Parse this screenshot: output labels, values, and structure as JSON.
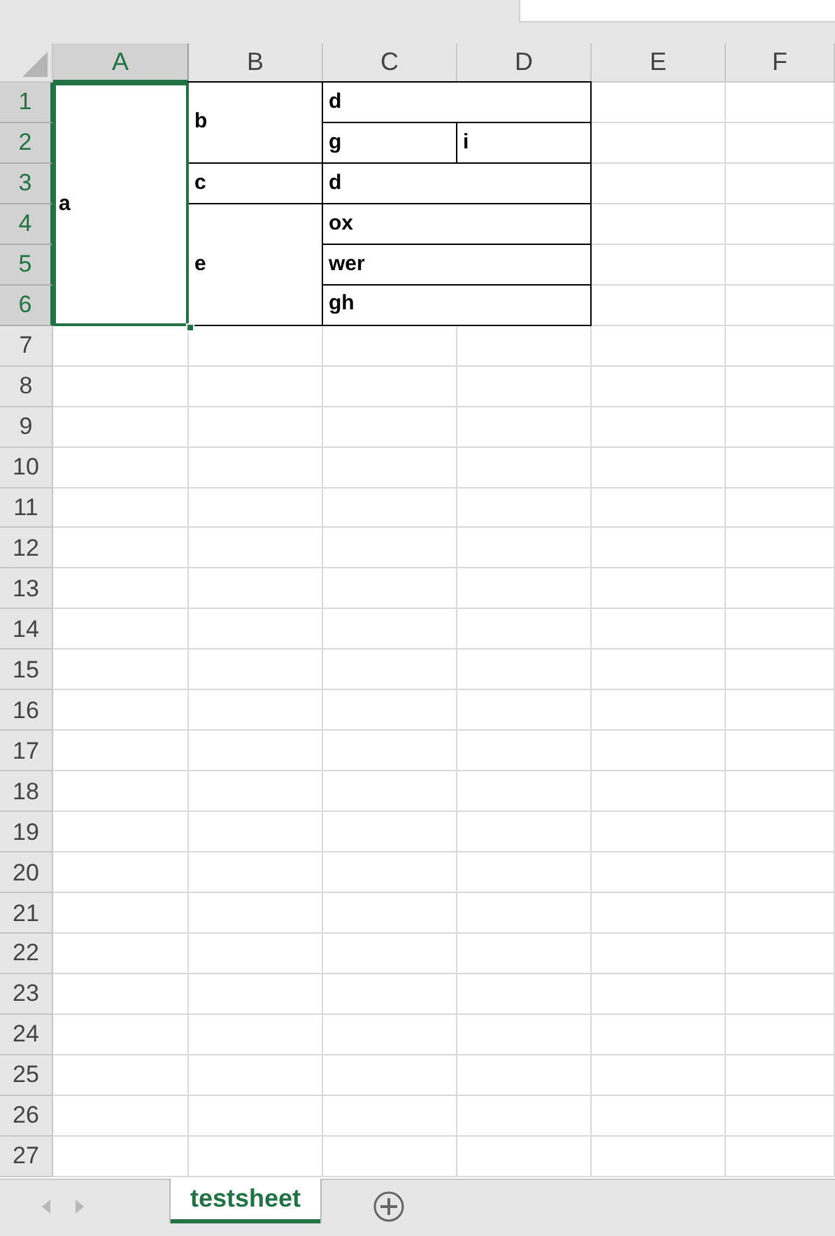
{
  "columns": [
    {
      "label": "A",
      "selected": true
    },
    {
      "label": "B",
      "selected": false
    },
    {
      "label": "C",
      "selected": false
    },
    {
      "label": "D",
      "selected": false
    },
    {
      "label": "E",
      "selected": false
    },
    {
      "label": "F",
      "selected": false
    }
  ],
  "rows": [
    {
      "label": "1",
      "selected": true
    },
    {
      "label": "2",
      "selected": true
    },
    {
      "label": "3",
      "selected": true
    },
    {
      "label": "4",
      "selected": true
    },
    {
      "label": "5",
      "selected": true
    },
    {
      "label": "6",
      "selected": true
    },
    {
      "label": "7",
      "selected": false
    },
    {
      "label": "8",
      "selected": false
    },
    {
      "label": "9",
      "selected": false
    },
    {
      "label": "10",
      "selected": false
    },
    {
      "label": "11",
      "selected": false
    },
    {
      "label": "12",
      "selected": false
    },
    {
      "label": "13",
      "selected": false
    },
    {
      "label": "14",
      "selected": false
    },
    {
      "label": "15",
      "selected": false
    },
    {
      "label": "16",
      "selected": false
    },
    {
      "label": "17",
      "selected": false
    },
    {
      "label": "18",
      "selected": false
    },
    {
      "label": "19",
      "selected": false
    },
    {
      "label": "20",
      "selected": false
    },
    {
      "label": "21",
      "selected": false
    },
    {
      "label": "22",
      "selected": false
    },
    {
      "label": "23",
      "selected": false
    },
    {
      "label": "24",
      "selected": false
    },
    {
      "label": "25",
      "selected": false
    },
    {
      "label": "26",
      "selected": false
    },
    {
      "label": "27",
      "selected": false
    }
  ],
  "grid_rows": [
    {
      "cells": [
        {
          "kind": "value",
          "text": "a",
          "selected": true,
          "bordered": false
        },
        {
          "kind": "value",
          "text": "b",
          "selected": false,
          "bordered": true
        },
        {
          "kind": "value",
          "text": "d",
          "selected": false,
          "bordered": true
        },
        {
          "kind": "merge_left"
        }
      ]
    },
    {
      "cells": [
        {
          "kind": "merge_up"
        },
        {
          "kind": "merge_up"
        },
        {
          "kind": "value",
          "text": "g",
          "selected": false,
          "bordered": true
        },
        {
          "kind": "value",
          "text": "i",
          "selected": false,
          "bordered": true
        }
      ]
    },
    {
      "cells": [
        {
          "kind": "merge_up"
        },
        {
          "kind": "value",
          "text": "c",
          "selected": false,
          "bordered": true
        },
        {
          "kind": "value",
          "text": "d",
          "selected": false,
          "bordered": true
        },
        {
          "kind": "merge_left"
        }
      ]
    },
    {
      "cells": [
        {
          "kind": "merge_up"
        },
        {
          "kind": "value",
          "text": "e",
          "selected": false,
          "bordered": true
        },
        {
          "kind": "value",
          "text": "ox",
          "selected": false,
          "bordered": true
        },
        {
          "kind": "merge_left"
        }
      ]
    },
    {
      "cells": [
        {
          "kind": "merge_up"
        },
        {
          "kind": "merge_up"
        },
        {
          "kind": "value",
          "text": "wer",
          "selected": false,
          "bordered": true
        },
        {
          "kind": "merge_left"
        }
      ]
    },
    {
      "cells": [
        {
          "kind": "merge_up"
        },
        {
          "kind": "merge_up"
        },
        {
          "kind": "value",
          "text": "gh",
          "selected": false,
          "bordered": true
        },
        {
          "kind": "merge_left"
        }
      ]
    }
  ],
  "sheet_tabs": [
    {
      "label": "testsheet",
      "selected": true
    }
  ]
}
